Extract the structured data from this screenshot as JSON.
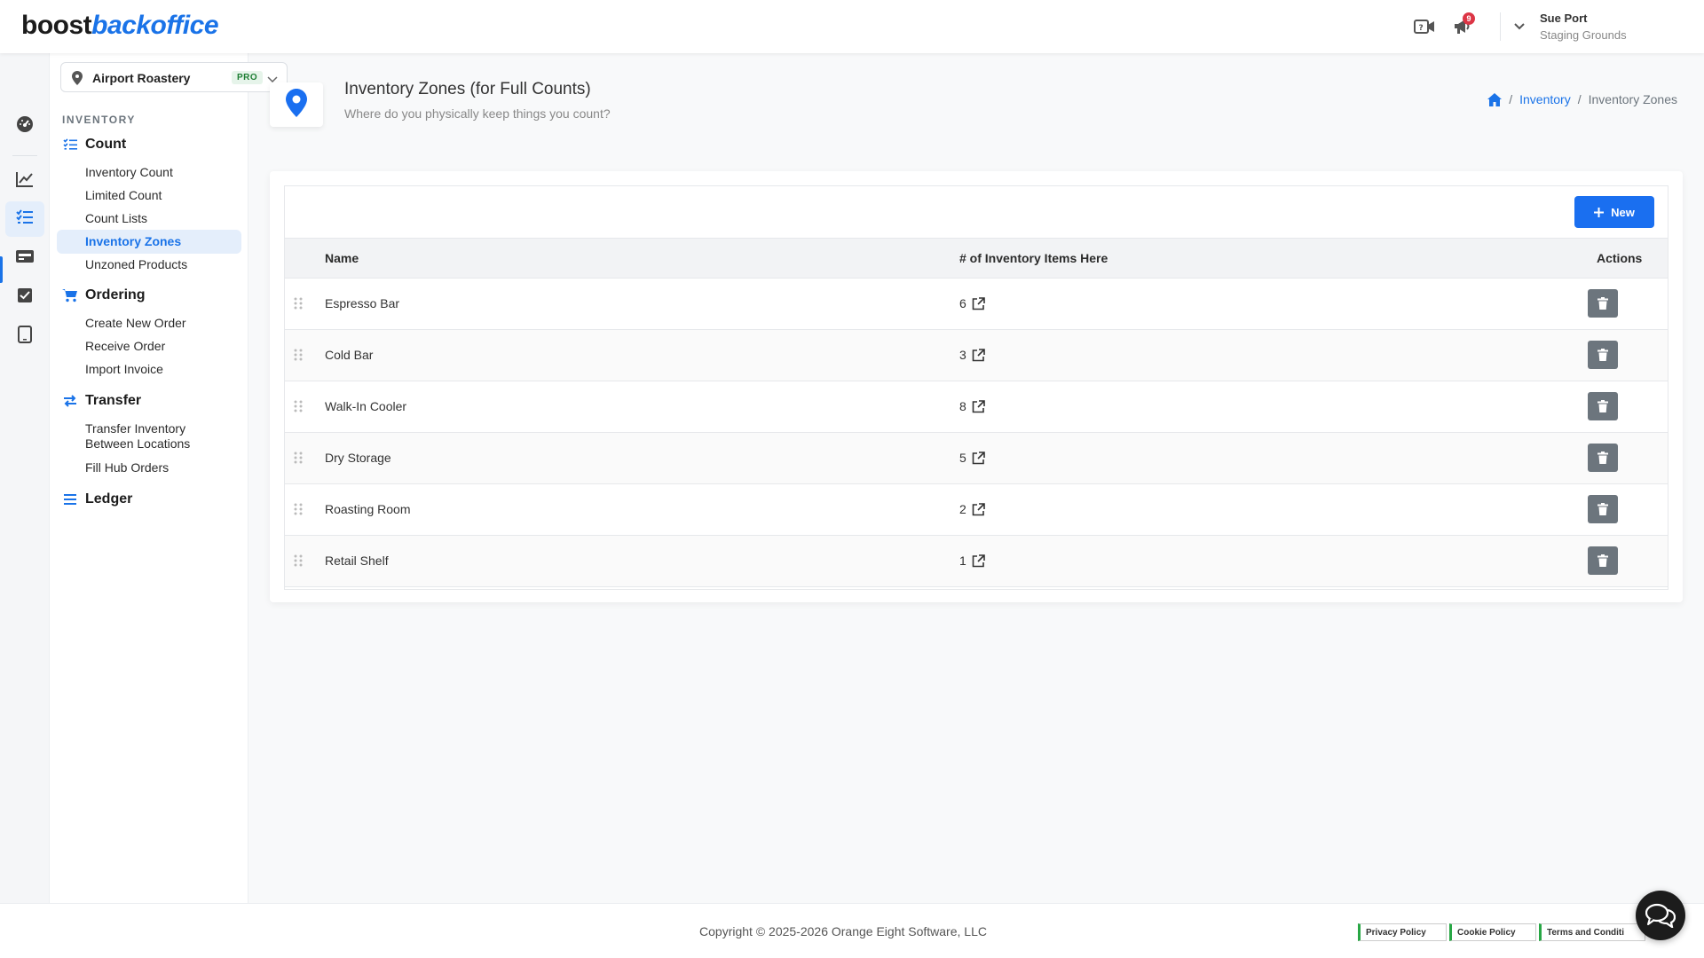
{
  "header": {
    "logo_part1": "boost",
    "logo_part2": "backoffice",
    "notification_count": "9",
    "user_name": "Sue Port",
    "user_location": "Staging Grounds"
  },
  "location_selector": {
    "name": "Airport Roastery",
    "badge": "PRO"
  },
  "nav": {
    "section_title": "INVENTORY",
    "groups": [
      {
        "label": "Count",
        "items": [
          "Inventory Count",
          "Limited Count",
          "Count Lists",
          "Inventory Zones",
          "Unzoned Products"
        ]
      },
      {
        "label": "Ordering",
        "items": [
          "Create New Order",
          "Receive Order",
          "Import Invoice"
        ]
      },
      {
        "label": "Transfer",
        "items": [
          "Transfer Inventory Between Locations",
          "Fill Hub Orders"
        ]
      },
      {
        "label": "Ledger",
        "items": []
      }
    ],
    "active_item": "Inventory Zones"
  },
  "page": {
    "title": "Inventory Zones (for Full Counts)",
    "subtitle": "Where do you physically keep things you count?",
    "breadcrumb": [
      "Inventory",
      "Inventory Zones"
    ]
  },
  "table": {
    "new_button": "New",
    "columns": [
      "Name",
      "# of Inventory Items Here",
      "Actions"
    ],
    "rows": [
      {
        "name": "Espresso Bar",
        "count": "6"
      },
      {
        "name": "Cold Bar",
        "count": "3"
      },
      {
        "name": "Walk-In Cooler",
        "count": "8"
      },
      {
        "name": "Dry Storage",
        "count": "5"
      },
      {
        "name": "Roasting Room",
        "count": "2"
      },
      {
        "name": "Retail Shelf",
        "count": "1"
      }
    ]
  },
  "footer": {
    "copyright": "Copyright © 2025-2026 Orange Eight Software, LLC",
    "links": [
      "Privacy Policy",
      "Cookie Policy",
      "Terms and Conditi"
    ]
  },
  "colors": {
    "accent": "#1a73e8",
    "danger": "#dc3545",
    "delete_button": "#6c757d"
  }
}
